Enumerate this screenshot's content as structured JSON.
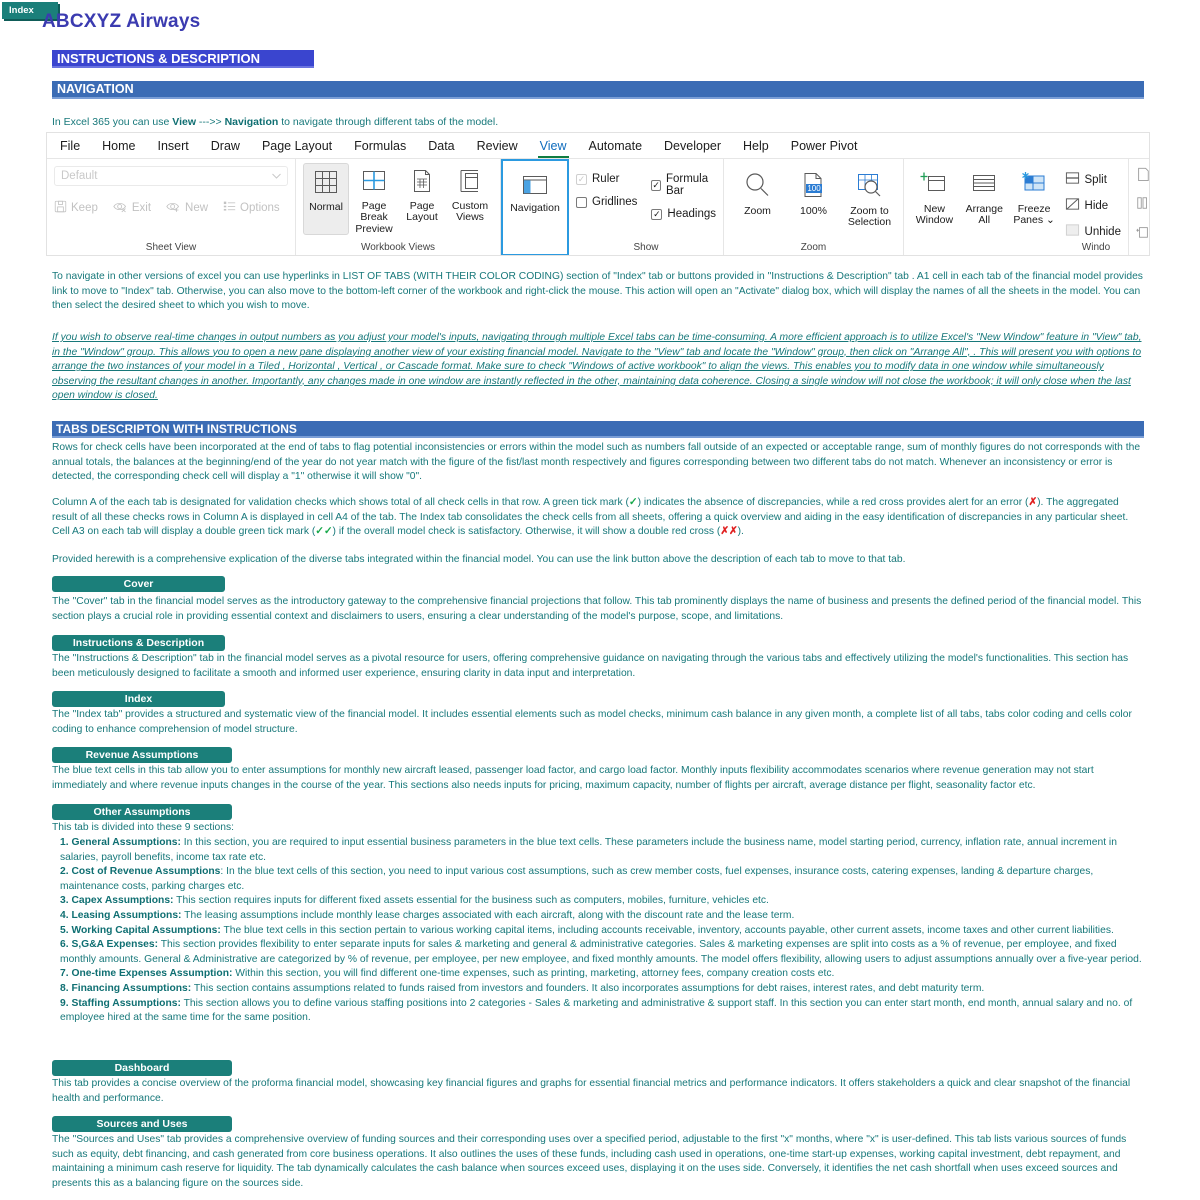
{
  "header": {
    "index_button": "Index",
    "brand": "ABCXYZ Airways",
    "instructions_bar": "INSTRUCTIONS & DESCRIPTION",
    "navigation_bar": "NAVIGATION",
    "nav_line_pre": "In Excel 365 you can use ",
    "nav_line_b1": "View",
    "nav_line_mid": "  --->> ",
    "nav_line_b2": "Navigation",
    "nav_line_post": " to navigate through different tabs of the model."
  },
  "ribbon": {
    "tabs": [
      "File",
      "Home",
      "Insert",
      "Draw",
      "Page Layout",
      "Formulas",
      "Data",
      "Review",
      "View",
      "Automate",
      "Developer",
      "Help",
      "Power Pivot"
    ],
    "active_tab": "View",
    "sheet_view": {
      "group_label": "Sheet View",
      "select_value": "Default",
      "chevron": "chevron-down-icon",
      "items": [
        "Keep",
        "Exit",
        "New",
        "Options"
      ]
    },
    "workbook_views": {
      "group_label": "Workbook Views",
      "items": [
        "Normal",
        "Page Break Preview",
        "Page Layout",
        "Custom Views"
      ],
      "selected": "Normal"
    },
    "navigation_group": {
      "label": "Navigation"
    },
    "show": {
      "group_label": "Show",
      "items": [
        {
          "label": "Ruler",
          "checked": true,
          "disabled": true
        },
        {
          "label": "Gridlines",
          "checked": false,
          "disabled": false
        },
        {
          "label": "Formula Bar",
          "checked": true,
          "disabled": false
        },
        {
          "label": "Headings",
          "checked": true,
          "disabled": false
        }
      ]
    },
    "zoom": {
      "group_label": "Zoom",
      "items": [
        "Zoom",
        "100%",
        "Zoom to Selection"
      ],
      "badge": "100"
    },
    "window": {
      "group_label": "Windo",
      "items": [
        "New Window",
        "Arrange All",
        "Freeze Panes"
      ],
      "freeze_chevron": "chevron-down-icon",
      "small_items": [
        {
          "label": "Split",
          "disabled": false
        },
        {
          "label": "Hide",
          "disabled": false
        },
        {
          "label": "Unhide",
          "disabled": true
        }
      ]
    }
  },
  "body": {
    "p_navigate": "To navigate in other versions of excel you can use hyperlinks in LIST OF TABS (WITH THEIR COLOR CODING) section of \"Index\" tab or buttons provided in  \"Instructions & Description\" tab . A1 cell in each tab of the financial model provides link to move to \"Index\" tab. Otherwise, you can also move to the bottom-left corner of the workbook and right-click the mouse. This action will open an \"Activate\" dialog box, which will display the names of all the sheets in the model. You can then select the desired sheet to which you wish to move.",
    "p_newwindow": "If you wish to observe real-time changes in output numbers as you adjust your model's inputs, navigating through multiple Excel tabs can be time-consuming. A more efficient approach is to utilize Excel's \"New Window\" feature in \"View\" tab, in the \"Window\" group. This allows you to open a new pane displaying another view of your existing financial model. Navigate to the \"View\" tab and locate the \"Window\" group, then click on \"Arrange All\", . This will present you with options to arrange the two instances of your model in a Tiled , Horizontal , Vertical , or Cascade format. Make sure to check \"Windows of active workbook\" to align the views. This  enables you to modify data in one window while simultaneously observing the resultant changes in another. Importantly, any changes made in one window are instantly reflected in the other, maintaining data coherence. Closing a single window will not close the workbook; it will only close when the last open window is closed.",
    "tabs_bar": "TABS DESCRIPTON WITH INSTRUCTIONS",
    "p_checkcells": "Rows for check cells have been incorporated at the end of tabs to flag potential inconsistencies or errors within the model such as numbers fall outside of an expected or acceptable range, sum of monthly figures do not corresponds with the annual totals, the balances at the beginning/end of the year do not year match with the figure of the fist/last month respectively and figures corresponding between two different tabs do not match. Whenever an inconsistency or error is detected, the corresponding check cell will display a \"1\" otherwise it will show \"0\".",
    "p_columna_1": "Column A of the each tab is designated for validation checks which shows total of all check cells in that row. A green tick mark (",
    "p_columna_tick": "✓",
    "p_columna_2": ") indicates the absence of discrepancies, while a red cross provides alert for an error (",
    "p_columna_cross": "✗",
    "p_columna_3": "). The aggregated result of all these checks rows in Column A is displayed in cell A4 of the tab. The Index tab consolidates the check cells from all sheets, offering a quick overview and aiding in the easy identification of discrepancies in any particular sheet. Cell A3 on each tab will display a double green tick mark (",
    "p_columna_tick2": "✓✓",
    "p_columna_4": ") if the overall model check is satisfactory. Otherwise, it will show a double red cross (",
    "p_columna_cross2": "✗✗",
    "p_columna_5": ").",
    "p_provided": "Provided herewith is a comprehensive explication of the diverse tabs integrated within the financial model. You can use the link button above the description of each tab to move to that tab."
  },
  "sections": [
    {
      "button": "Cover",
      "text": "The \"Cover\" tab in the financial model serves as the introductory gateway to the comprehensive financial projections that follow. This tab prominently displays the name of business and presents the defined period of the financial model. This section plays  a crucial role in providing essential context and disclaimers to users, ensuring a clear understanding of the model's purpose, scope, and limitations."
    },
    {
      "button": "Instructions & Description",
      "text": "The \"Instructions & Description\" tab in the financial model serves as a pivotal resource for users, offering comprehensive guidance on navigating through the various tabs and effectively utilizing the model's functionalities. This section has been meticulously designed to facilitate a smooth and informed user experience, ensuring clarity in data input and interpretation."
    },
    {
      "button": "Index",
      "text": "The \"Index tab\" provides a structured and systematic view of the financial model. It includes essential elements such as model checks, minimum cash balance in any given month, a complete list of all tabs, tabs color coding and cells color coding to enhance comprehension of model structure."
    },
    {
      "button": "Revenue Assumptions",
      "text": "The blue text cells in this tab allow you to enter assumptions for monthly new aircraft leased, passenger load factor, and cargo load factor. Monthly inputs flexibility accommodates scenarios where revenue generation may not start  immediately and where revenue inputs changes in the course of the year. This sections also needs inputs for pricing, maximum capacity, number of flights per aircraft, average distance per flight, seasonality factor etc."
    },
    {
      "button": "Other Assumptions",
      "text": "This tab is divided into these 9 sections:"
    },
    {
      "button": "Dashboard",
      "text": "This tab provides a concise overview of the proforma financial model, showcasing key financial figures and graphs for essential financial metrics and performance indicators. It offers stakeholders a quick and clear snapshot of the financial health and performance."
    },
    {
      "button": "Sources and Uses",
      "text": "The \"Sources and Uses\" tab provides a comprehensive overview of funding sources and their corresponding uses over a specified period, adjustable to the first \"x\" months, where \"x\" is user-defined. This tab lists various sources of funds such as equity, debt financing, and cash generated from core business operations. It also outlines the uses of these funds, including cash used in operations, one-time start-up expenses, working capital investment, debt repayment, and maintaining  a minimum cash reserve for liquidity. The tab dynamically calculates the cash balance when sources exceed uses, displaying it on the uses side. Conversely, it identifies the net cash shortfall when uses exceed sources and presents this as a balancing figure on the sources side."
    }
  ],
  "other_assumptions_list": [
    {
      "num": "1. ",
      "title": "General Assumptions:",
      "text": " In this section, you are required to input essential business parameters in the blue text cells. These parameters include the business name, model starting period, currency, inflation rate, annual increment in salaries, payroll benefits, income tax rate etc."
    },
    {
      "num": "2. ",
      "title": "Cost of Revenue Assumptions",
      "text": ": In the blue text cells of this section, you need to input various cost assumptions, such as crew member costs, fuel expenses, insurance costs, catering expenses, landing & departure charges, maintenance costs, parking charges etc."
    },
    {
      "num": "3. ",
      "title": "Capex Assumptions:",
      "text": " This section requires inputs for different fixed assets essential for the business such as computers, mobiles, furniture, vehicles etc."
    },
    {
      "num": "4. ",
      "title": "Leasing Assumptions:",
      "text": " The leasing assumptions include monthly lease charges associated with each aircraft, along with  the discount rate and the lease term."
    },
    {
      "num": "5. ",
      "title": "Working Capital Assumptions:",
      "text": " The blue text cells in this section pertain to various working capital items, including accounts receivable, inventory, accounts payable, other current assets, income taxes and other current liabilities."
    },
    {
      "num": "6. ",
      "title": "S,G&A Expenses:",
      "text": " This section provides flexibility to enter separate inputs for sales & marketing and general & administrative categories. Sales & marketing expenses are split into costs as a % of revenue, per employee, and fixed monthly amounts. General & Administrative are categorized by % of revenue, per employee, per new employee, and fixed monthly amounts. The model offers flexibility, allowing users to adjust assumptions annually  over a  five-year period."
    },
    {
      "num": "7. ",
      "title": "One-time Expenses Assumption:",
      "text": " Within this section, you will find different one-time expenses, such as printing, marketing, attorney fees, company creation costs etc."
    },
    {
      "num": "8. ",
      "title": "Financing Assumptions:",
      "text": " This section contains assumptions related to funds raised from investors and founders. It also incorporates assumptions for debt raises, interest rates, and debt maturity term."
    },
    {
      "num": "9. ",
      "title": "Staffing Assumptions:",
      "text": " This section allows you to define various staffing positions into 2 categories - Sales & marketing and administrative & support staff. In this section you can enter start month, end month, annual salary and no. of employee hired at  the same time for the same position."
    }
  ],
  "colors": {
    "teal": "#1b7f7a",
    "text_teal": "#17787a",
    "blue_bar": "#3a45cf",
    "steel_bar": "#3b6cb5",
    "brand_purple": "#3b3bb0",
    "highlight_blue": "#2b9ae0"
  }
}
